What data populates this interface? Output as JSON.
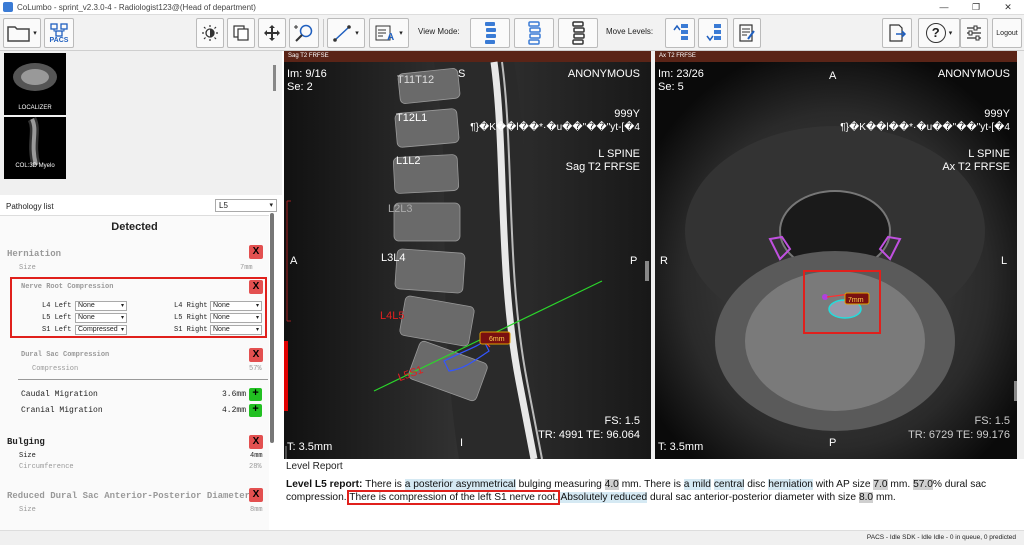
{
  "window": {
    "title": "CoLumbo - sprint_v2.3.0-4 - Radiologist123@(Head of department)",
    "minimize": "—",
    "maximize": "❐",
    "close": "✕"
  },
  "toolbar": {
    "pacs_label": "PACS",
    "view_mode_label": "View Mode:",
    "move_levels_label": "Move Levels:",
    "logout_label": "Logout",
    "help_label": "?"
  },
  "thumbnails": [
    {
      "label": "LOCALIZER"
    },
    {
      "label": "COL:3D Myelo"
    }
  ],
  "pathology": {
    "list_label": "Pathology list",
    "level": "L5",
    "heading": "Detected",
    "herniation": {
      "title": "Herniation",
      "size_label": "Size",
      "size_value": "7mm"
    },
    "nerve": {
      "title": "Nerve Root Compression",
      "rows": [
        {
          "left_label": "L4 Left",
          "left_value": "None",
          "right_label": "L4 Right",
          "right_value": "None"
        },
        {
          "left_label": "L5 Left",
          "left_value": "None",
          "right_label": "L5 Right",
          "right_value": "None"
        },
        {
          "left_label": "S1 Left",
          "left_value": "Compressed",
          "right_label": "S1 Right",
          "right_value": "None"
        }
      ]
    },
    "dural": {
      "title": "Dural Sac Compression",
      "label": "Compression",
      "value": "57%"
    },
    "migration": {
      "caudal_label": "Caudal Migration",
      "caudal_value": "3.6mm",
      "cranial_label": "Cranial Migration",
      "cranial_value": "4.2mm"
    },
    "bulging": {
      "title": "Bulging",
      "size_label": "Size",
      "size_value": "4mm",
      "circ_label": "Circumference",
      "circ_value": "28%"
    },
    "reduced": {
      "title": "Reduced Dural Sac Anterior-Posterior Diameter",
      "size_label": "Size",
      "size_value": "8mm"
    },
    "x_glyph": "X",
    "plus_glyph": "+"
  },
  "sag_view": {
    "header": "Sag T2 FRFSE",
    "im": "Im: 9/16",
    "se": "Se: 2",
    "patient": "ANONYMOUS",
    "age": "999Y",
    "garbled": "¶}�K��l��*·�u��\"��\"yt-[�4",
    "region": "L SPINE",
    "series": "Sag T2 FRFSE",
    "orient_top": "S",
    "orient_left": "A",
    "orient_right": "P",
    "orient_bottom": "I",
    "thickness": "T: 3.5mm",
    "fs": "FS: 1.5",
    "tr_te": "TR: 4991 TE: 96.064",
    "levels": [
      "T11T12",
      "T12L1",
      "L1L2",
      "L2L3",
      "L3L4",
      "L4L5",
      "L5S1"
    ],
    "measure": "6mm"
  },
  "ax_view": {
    "header": "Ax T2 FRFSE",
    "im": "Im: 23/26",
    "se": "Se: 5",
    "patient": "ANONYMOUS",
    "age": "999Y",
    "garbled": "¶}�K��l��*·�u��\"��\"yt-[�4",
    "region": "L SPINE",
    "series": "Ax T2 FRFSE",
    "orient_top": "A",
    "orient_left": "R",
    "orient_right": "L",
    "orient_bottom": "P",
    "thickness": "T: 3.5mm",
    "fs": "FS: 1.5",
    "tr_te": "TR: 6729 TE: 99.176",
    "measure": "7mm"
  },
  "report": {
    "title": "Level Report",
    "level_label": "Level L5 report:",
    "p1": "There is",
    "p2": "a posterior asymmetrical",
    "p3": "bulging measuring",
    "p4": "4.0",
    "p5": "mm. There is",
    "p6": "a mild",
    "p7": "central",
    "p8": "disc",
    "p9": "herniation",
    "p10": "with AP size",
    "p11": "7.0",
    "p12": "mm.",
    "p13": "57.0",
    "p14": "% dural sac compression.",
    "p15": "There is compression of the left S1 nerve root.",
    "p16": "Absolutely reduced",
    "p17": "dural sac anterior-posterior diameter with size",
    "p18": "8.0",
    "p19": "mm."
  },
  "status": "PACS - Idle SDK - Idle Idle - 0 in queue, 0 predicted",
  "colors": {
    "accent_red": "#e0201c",
    "x_red": "#e35050",
    "plus_green": "#22c022",
    "viewer_header": "#5a2417",
    "highlight": "#d5e9f3"
  }
}
